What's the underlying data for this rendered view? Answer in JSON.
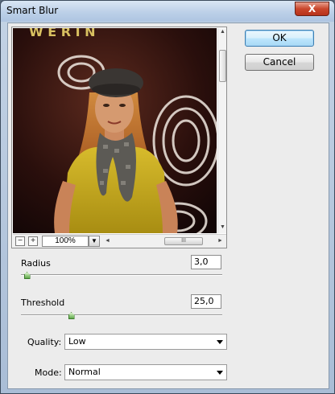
{
  "window": {
    "title": "Smart Blur",
    "close_label": "X"
  },
  "preview": {
    "zoom_out_label": "−",
    "zoom_in_label": "+",
    "zoom_value": "100%",
    "dropdown_label": "▼",
    "backdrop_text": "W E R  I N",
    "scroll_up": "▲",
    "scroll_down": "▼",
    "scroll_left": "◄",
    "scroll_right": "►",
    "hthumb_grip": "III"
  },
  "buttons": {
    "ok_label": "OK",
    "cancel_label": "Cancel"
  },
  "radius": {
    "label": "Radius",
    "value": "3,0",
    "level": 0.03
  },
  "threshold": {
    "label": "Threshold",
    "value": "25,0",
    "level": 0.25
  },
  "quality": {
    "label": "Quality:",
    "selected": "Low"
  },
  "mode": {
    "label": "Mode:",
    "selected": "Normal"
  },
  "colors": {
    "knob": "#5fa94a",
    "accent": "#3c7fb1"
  },
  "icons": [
    "close-icon",
    "zoom-out-icon",
    "zoom-in-icon",
    "chevron-down-icon",
    "slider-knob-icon"
  ]
}
